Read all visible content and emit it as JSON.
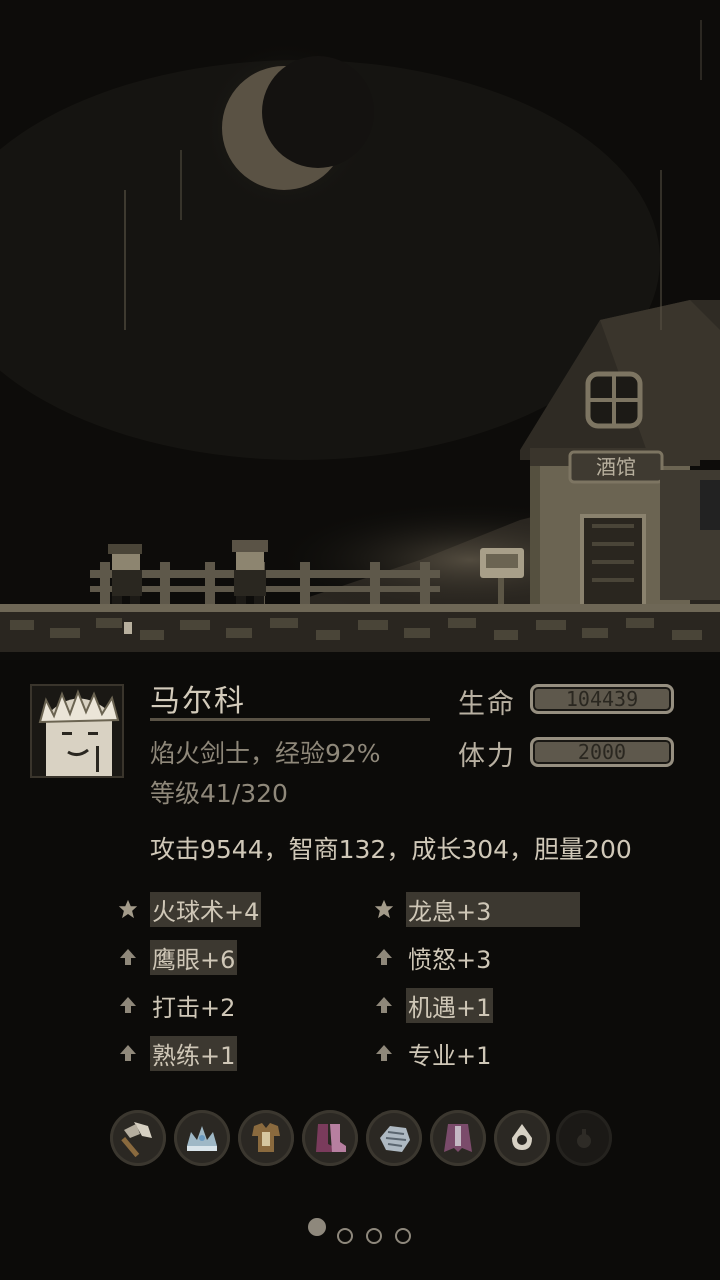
{
  "tavern_sign": "酒馆",
  "character": {
    "name": "马尔科",
    "class_exp": "焰火剑士，经验92%",
    "level": "等级41/320"
  },
  "stats": {
    "hp_label": "生命",
    "hp_value": "104439",
    "stamina_label": "体力",
    "stamina_value": "2000"
  },
  "attributes": "攻击9544，智商132，成长304，胆量200",
  "skills": [
    {
      "icon": "star-icon",
      "label": "火球术+4"
    },
    {
      "icon": "star-icon",
      "label": "龙息+3"
    },
    {
      "icon": "up-arrow-icon",
      "label": "鹰眼+6"
    },
    {
      "icon": "up-arrow-icon",
      "label": "愤怒+3"
    },
    {
      "icon": "up-arrow-icon",
      "label": "打击+2"
    },
    {
      "icon": "up-arrow-icon",
      "label": "机遇+1"
    },
    {
      "icon": "up-arrow-icon",
      "label": "熟练+1"
    },
    {
      "icon": "up-arrow-icon",
      "label": "专业+1"
    }
  ],
  "equipment": [
    {
      "icon": "axe-icon"
    },
    {
      "icon": "crown-icon"
    },
    {
      "icon": "armor-icon"
    },
    {
      "icon": "boots-icon"
    },
    {
      "icon": "gauntlet-icon"
    },
    {
      "icon": "cape-icon"
    },
    {
      "icon": "ring-icon"
    },
    {
      "icon": "empty-slot-icon"
    }
  ],
  "pagination": {
    "current": 1,
    "total": 4
  },
  "colors": {
    "background": "#0c0b09",
    "text": "#cfc7b7",
    "muted": "#8f887a"
  }
}
